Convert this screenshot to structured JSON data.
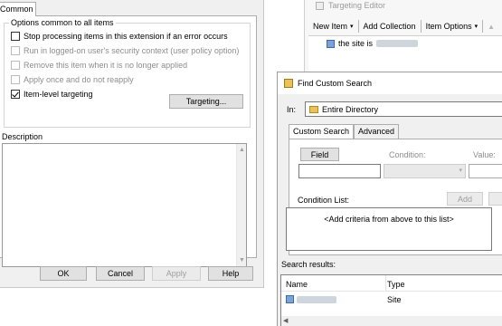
{
  "properties_dialog": {
    "tab_label": "Common",
    "group_title": "Options common to all items",
    "options": [
      {
        "label": "Stop processing items in this extension if an error occurs",
        "checked": false,
        "enabled": true
      },
      {
        "label": "Run in logged-on user's security context (user policy option)",
        "checked": false,
        "enabled": false
      },
      {
        "label": "Remove this item when it is no longer applied",
        "checked": false,
        "enabled": false
      },
      {
        "label": "Apply once and do not reapply",
        "checked": false,
        "enabled": false
      },
      {
        "label": "Item-level targeting",
        "checked": true,
        "enabled": true
      }
    ],
    "targeting_button": "Targeting...",
    "description_label": "Description",
    "description_value": "",
    "buttons": {
      "ok": "OK",
      "cancel": "Cancel",
      "apply": "Apply",
      "help": "Help"
    }
  },
  "targeting_editor": {
    "title": "Targeting Editor",
    "toolbar": {
      "new_item": "New Item",
      "add_collection": "Add Collection",
      "item_options": "Item Options"
    },
    "tree_item": "the site is"
  },
  "find_dialog": {
    "title": "Find Custom Search",
    "in_label": "In:",
    "in_value": "Entire Directory",
    "tabs": [
      "Custom Search",
      "Advanced"
    ],
    "field_button": "Field",
    "condition_label": "Condition:",
    "value_label": "Value:",
    "condition_list_label": "Condition List:",
    "add_button": "Add",
    "condition_list_placeholder": "<Add criteria from above to this list>",
    "results_label": "Search results:",
    "columns": {
      "name": "Name",
      "type": "Type"
    },
    "rows": [
      {
        "type": "Site"
      }
    ]
  }
}
